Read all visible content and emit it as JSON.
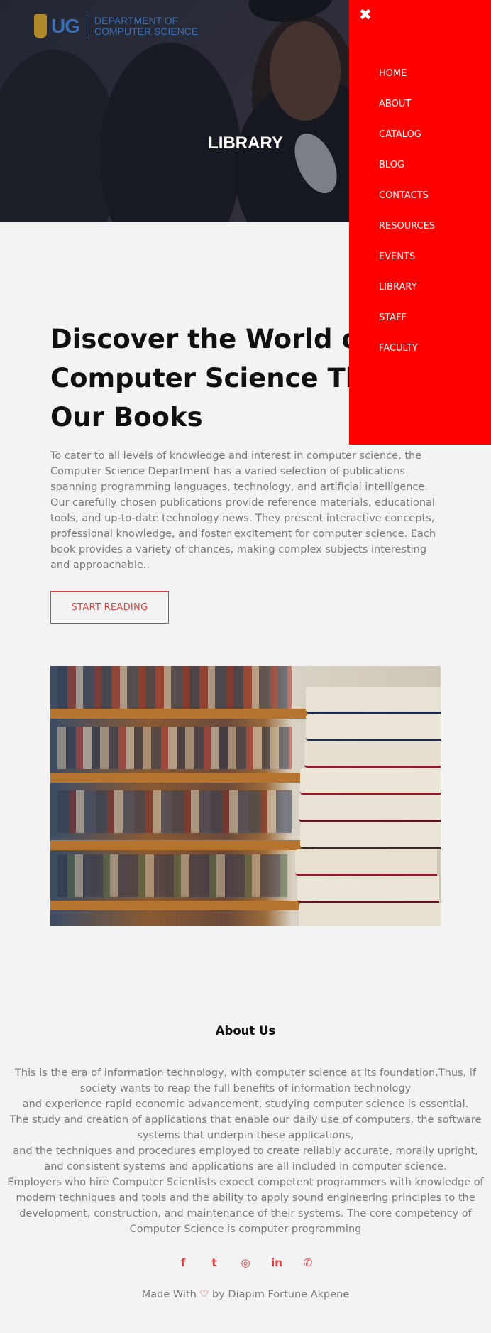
{
  "header": {
    "logo_ug": "UG",
    "logo_dept_line1": "DEPARTMENT OF",
    "logo_dept_line2": "COMPUTER SCIENCE",
    "title": "LIBRARY"
  },
  "nav": {
    "close_icon": "close-icon",
    "items": [
      "HOME",
      "ABOUT",
      "CATALOG",
      "BLOG",
      "CONTACTS",
      "RESOURCES",
      "EVENTS",
      "LIBRARY",
      "STAFF",
      "FACULTY"
    ],
    "background_color": "#ff0000"
  },
  "main": {
    "headline_line1": "Discover the World of",
    "headline_line2": "Computer Science Thro",
    "headline_line3": "Our Books",
    "intro": "To cater to all levels of knowledge and interest in computer science, the Computer Science Department has a varied selection of publications spanning programming languages, technology, and artificial intelligence. Our carefully chosen publications provide reference materials, educational tools, and up-to-date technology news. They present interactive concepts, professional knowledge, and foster excitement for computer science. Each book provides a variety of chances, making complex subjects interesting and approachable..",
    "cta_label": "START READING",
    "accent_color": "#e23a3a"
  },
  "about": {
    "title": "About Us",
    "lines": [
      "This is the era of information technology, with computer science at its foundation.Thus, if society wants to reap the full benefits of information technology",
      "and experience rapid economic advancement, studying computer science is essential.",
      "The study and creation of applications that enable our daily use of computers, the software systems that underpin these applications,",
      "and the techniques and procedures employed to create reliably accurate, morally upright, and consistent systems and applications are all included in computer science.",
      "Employers who hire Computer Scientists expect competent programmers with knowledge of modern techniques and tools and the ability to apply sound engineering principles to the development, construction, and maintenance of their systems. The core competency of Computer Science is computer programming"
    ]
  },
  "social": {
    "icons": [
      "facebook-icon",
      "twitter-icon",
      "instagram-icon",
      "linkedin-icon",
      "whatsapp-icon"
    ],
    "glyphs": [
      "f",
      "t",
      "◎",
      "in",
      "✆"
    ]
  },
  "footer": {
    "made_with": "Made With",
    "heart": "♡",
    "by": "by Diapim Fortune Akpene"
  }
}
